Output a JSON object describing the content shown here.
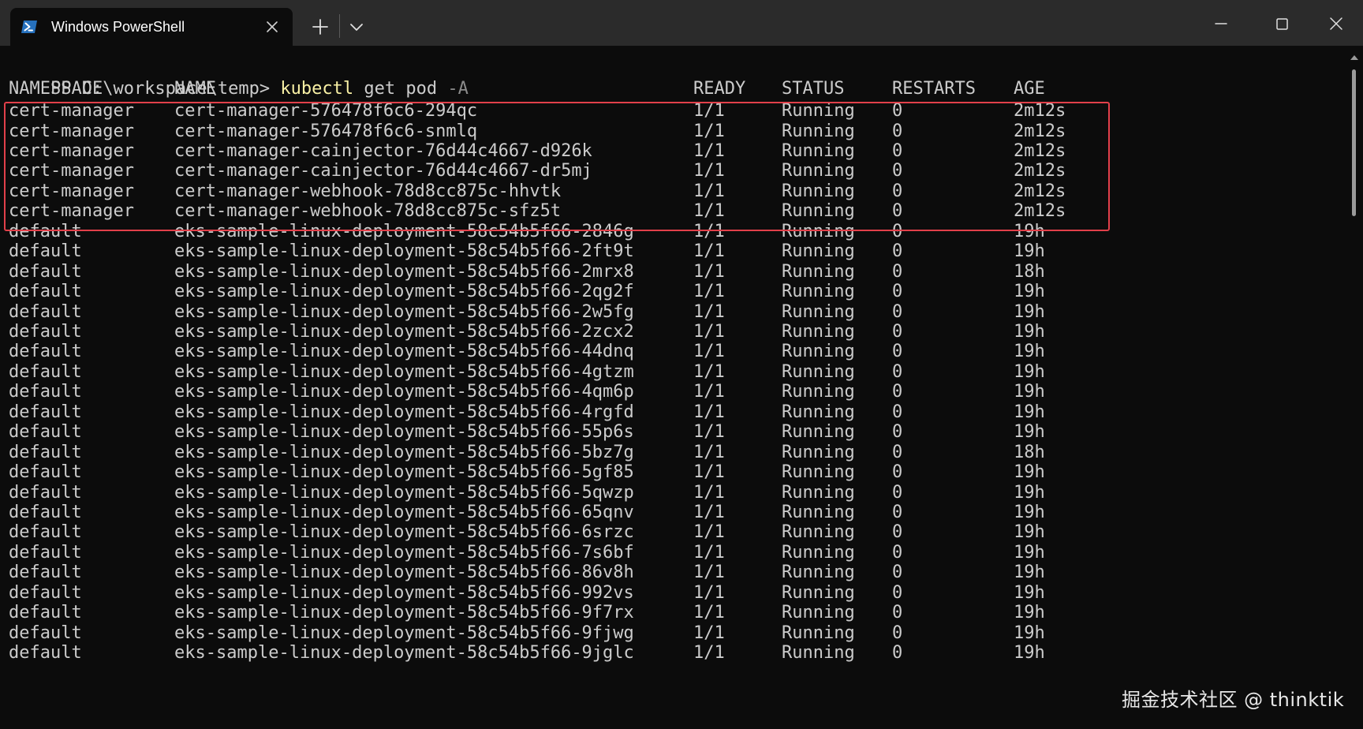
{
  "window": {
    "tab_title": "Windows PowerShell"
  },
  "icons": {
    "tab_icon": "powershell-icon",
    "tab_close": "close-icon",
    "new_tab": "plus-icon",
    "dropdown": "chevron-down-icon",
    "minimize": "minimize-icon",
    "maximize": "maximize-icon",
    "close": "close-icon"
  },
  "terminal": {
    "prompt": "PS D:\\workspace\\temp> ",
    "command": "kubectl",
    "args": " get pod ",
    "flag": "-A",
    "headers": {
      "namespace": "NAMESPACE",
      "name": "NAME",
      "ready": "READY",
      "status": "STATUS",
      "restarts": "RESTARTS",
      "age": "AGE"
    },
    "rows": [
      {
        "namespace": "cert-manager",
        "name": "cert-manager-576478f6c6-294qc",
        "ready": "1/1",
        "status": "Running",
        "restarts": "0",
        "age": "2m12s"
      },
      {
        "namespace": "cert-manager",
        "name": "cert-manager-576478f6c6-snmlq",
        "ready": "1/1",
        "status": "Running",
        "restarts": "0",
        "age": "2m12s"
      },
      {
        "namespace": "cert-manager",
        "name": "cert-manager-cainjector-76d44c4667-d926k",
        "ready": "1/1",
        "status": "Running",
        "restarts": "0",
        "age": "2m12s"
      },
      {
        "namespace": "cert-manager",
        "name": "cert-manager-cainjector-76d44c4667-dr5mj",
        "ready": "1/1",
        "status": "Running",
        "restarts": "0",
        "age": "2m12s"
      },
      {
        "namespace": "cert-manager",
        "name": "cert-manager-webhook-78d8cc875c-hhvtk",
        "ready": "1/1",
        "status": "Running",
        "restarts": "0",
        "age": "2m12s"
      },
      {
        "namespace": "cert-manager",
        "name": "cert-manager-webhook-78d8cc875c-sfz5t",
        "ready": "1/1",
        "status": "Running",
        "restarts": "0",
        "age": "2m12s"
      },
      {
        "namespace": "default",
        "name": "eks-sample-linux-deployment-58c54b5f66-2846g",
        "ready": "1/1",
        "status": "Running",
        "restarts": "0",
        "age": "19h"
      },
      {
        "namespace": "default",
        "name": "eks-sample-linux-deployment-58c54b5f66-2ft9t",
        "ready": "1/1",
        "status": "Running",
        "restarts": "0",
        "age": "19h"
      },
      {
        "namespace": "default",
        "name": "eks-sample-linux-deployment-58c54b5f66-2mrx8",
        "ready": "1/1",
        "status": "Running",
        "restarts": "0",
        "age": "18h"
      },
      {
        "namespace": "default",
        "name": "eks-sample-linux-deployment-58c54b5f66-2qg2f",
        "ready": "1/1",
        "status": "Running",
        "restarts": "0",
        "age": "19h"
      },
      {
        "namespace": "default",
        "name": "eks-sample-linux-deployment-58c54b5f66-2w5fg",
        "ready": "1/1",
        "status": "Running",
        "restarts": "0",
        "age": "19h"
      },
      {
        "namespace": "default",
        "name": "eks-sample-linux-deployment-58c54b5f66-2zcx2",
        "ready": "1/1",
        "status": "Running",
        "restarts": "0",
        "age": "19h"
      },
      {
        "namespace": "default",
        "name": "eks-sample-linux-deployment-58c54b5f66-44dnq",
        "ready": "1/1",
        "status": "Running",
        "restarts": "0",
        "age": "19h"
      },
      {
        "namespace": "default",
        "name": "eks-sample-linux-deployment-58c54b5f66-4gtzm",
        "ready": "1/1",
        "status": "Running",
        "restarts": "0",
        "age": "19h"
      },
      {
        "namespace": "default",
        "name": "eks-sample-linux-deployment-58c54b5f66-4qm6p",
        "ready": "1/1",
        "status": "Running",
        "restarts": "0",
        "age": "19h"
      },
      {
        "namespace": "default",
        "name": "eks-sample-linux-deployment-58c54b5f66-4rgfd",
        "ready": "1/1",
        "status": "Running",
        "restarts": "0",
        "age": "19h"
      },
      {
        "namespace": "default",
        "name": "eks-sample-linux-deployment-58c54b5f66-55p6s",
        "ready": "1/1",
        "status": "Running",
        "restarts": "0",
        "age": "19h"
      },
      {
        "namespace": "default",
        "name": "eks-sample-linux-deployment-58c54b5f66-5bz7g",
        "ready": "1/1",
        "status": "Running",
        "restarts": "0",
        "age": "18h"
      },
      {
        "namespace": "default",
        "name": "eks-sample-linux-deployment-58c54b5f66-5gf85",
        "ready": "1/1",
        "status": "Running",
        "restarts": "0",
        "age": "19h"
      },
      {
        "namespace": "default",
        "name": "eks-sample-linux-deployment-58c54b5f66-5qwzp",
        "ready": "1/1",
        "status": "Running",
        "restarts": "0",
        "age": "19h"
      },
      {
        "namespace": "default",
        "name": "eks-sample-linux-deployment-58c54b5f66-65qnv",
        "ready": "1/1",
        "status": "Running",
        "restarts": "0",
        "age": "19h"
      },
      {
        "namespace": "default",
        "name": "eks-sample-linux-deployment-58c54b5f66-6srzc",
        "ready": "1/1",
        "status": "Running",
        "restarts": "0",
        "age": "19h"
      },
      {
        "namespace": "default",
        "name": "eks-sample-linux-deployment-58c54b5f66-7s6bf",
        "ready": "1/1",
        "status": "Running",
        "restarts": "0",
        "age": "19h"
      },
      {
        "namespace": "default",
        "name": "eks-sample-linux-deployment-58c54b5f66-86v8h",
        "ready": "1/1",
        "status": "Running",
        "restarts": "0",
        "age": "19h"
      },
      {
        "namespace": "default",
        "name": "eks-sample-linux-deployment-58c54b5f66-992vs",
        "ready": "1/1",
        "status": "Running",
        "restarts": "0",
        "age": "19h"
      },
      {
        "namespace": "default",
        "name": "eks-sample-linux-deployment-58c54b5f66-9f7rx",
        "ready": "1/1",
        "status": "Running",
        "restarts": "0",
        "age": "19h"
      },
      {
        "namespace": "default",
        "name": "eks-sample-linux-deployment-58c54b5f66-9fjwg",
        "ready": "1/1",
        "status": "Running",
        "restarts": "0",
        "age": "19h"
      },
      {
        "namespace": "default",
        "name": "eks-sample-linux-deployment-58c54b5f66-9jglc",
        "ready": "1/1",
        "status": "Running",
        "restarts": "0",
        "age": "19h"
      }
    ]
  },
  "watermark": "掘金技术社区 @ thinktik",
  "colors": {
    "terminal_bg": "#0c0c0c",
    "titlebar_bg": "#2b2b2b",
    "text": "#cccccc",
    "command": "#f9f1a5",
    "flag": "#8b8b8b",
    "highlight": "#e2404a",
    "powershell_blue": "#2671be"
  }
}
